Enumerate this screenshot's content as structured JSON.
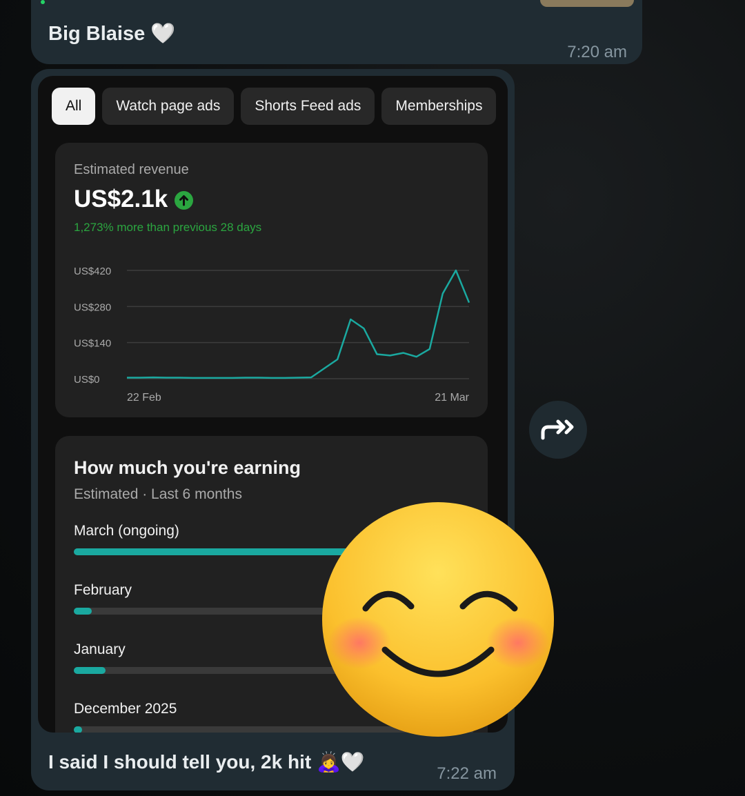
{
  "top_message": {
    "sender": "Big Blaise",
    "emoji": "🤍",
    "time": "7:20 am"
  },
  "main_message": {
    "caption": "I said I should tell you, 2k hit",
    "caption_emojis": "🙇‍♀️🤍",
    "time": "7:22 am",
    "forward_icon": "double-forward-arrow-icon",
    "reaction": "smiling-face-with-smiling-eyes-emoji"
  },
  "screenshot": {
    "chips": [
      "All",
      "Watch page ads",
      "Shorts Feed ads",
      "Memberships"
    ],
    "active_chip": "All",
    "revenue": {
      "label": "Estimated revenue",
      "value": "US$2.1k",
      "delta": "1,273% more than previous 28 days",
      "up_icon": "arrow-up-circle-icon"
    },
    "earning": {
      "title": "How much you're earning",
      "subtitle": "Estimated · Last 6 months",
      "months": [
        {
          "label": "March (ongoing)",
          "fraction": 0.92
        },
        {
          "label": "February",
          "fraction": 0.045
        },
        {
          "label": "January",
          "fraction": 0.08
        },
        {
          "label": "December 2025",
          "fraction": 0.02
        }
      ]
    }
  },
  "colors": {
    "bubble": "#202c33",
    "accent_teal": "#1aa9a0",
    "green": "#2ba640",
    "background": "#0d0f10"
  },
  "chart_data": {
    "type": "line",
    "x_start_label": "22 Feb",
    "x_end_label": "21 Mar",
    "y_ticks": [
      "US$0",
      "US$140",
      "US$280",
      "US$420"
    ],
    "ylim": [
      0,
      420
    ],
    "grid": true,
    "series": [
      {
        "values": [
          4,
          4,
          5,
          4,
          4,
          3,
          3,
          3,
          3,
          4,
          4,
          3,
          3,
          4,
          5,
          40,
          75,
          230,
          195,
          95,
          90,
          100,
          85,
          115,
          330,
          420,
          295
        ]
      }
    ]
  }
}
